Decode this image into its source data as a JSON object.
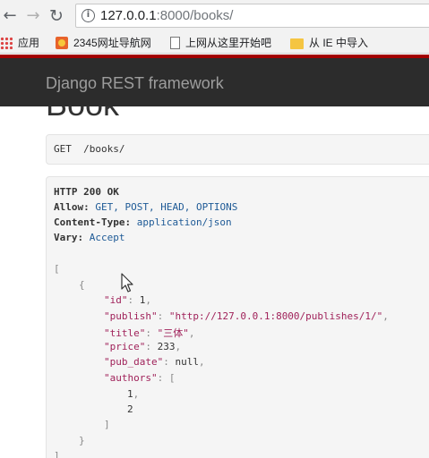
{
  "browser": {
    "url_host": "127.0.0.1",
    "url_rest": ":8000/books/",
    "bookmarks": [
      {
        "label": "应用",
        "icon": "apps-grid-icon"
      },
      {
        "label": "2345网址导航网",
        "icon": "site-logo-icon"
      },
      {
        "label": "上网从这里开始吧",
        "icon": "page-icon"
      },
      {
        "label": "从 IE 中导入",
        "icon": "folder-icon"
      }
    ]
  },
  "navbar": {
    "brand": "Django REST framework"
  },
  "page": {
    "title": "Book"
  },
  "request": {
    "line": "GET  /books/"
  },
  "response": {
    "status": "HTTP 200 OK",
    "headers": [
      {
        "name": "Allow:",
        "value": " GET, POST, HEAD, OPTIONS"
      },
      {
        "name": "Content-Type:",
        "value": " application/json"
      },
      {
        "name": "Vary:",
        "value": " Accept"
      }
    ],
    "body": {
      "id": "1",
      "publish": "\"http://127.0.0.1:8000/publishes/1/\"",
      "title": "\"三体\"",
      "price": "233",
      "pub_date": "null",
      "authors": [
        "1",
        "2"
      ]
    }
  }
}
